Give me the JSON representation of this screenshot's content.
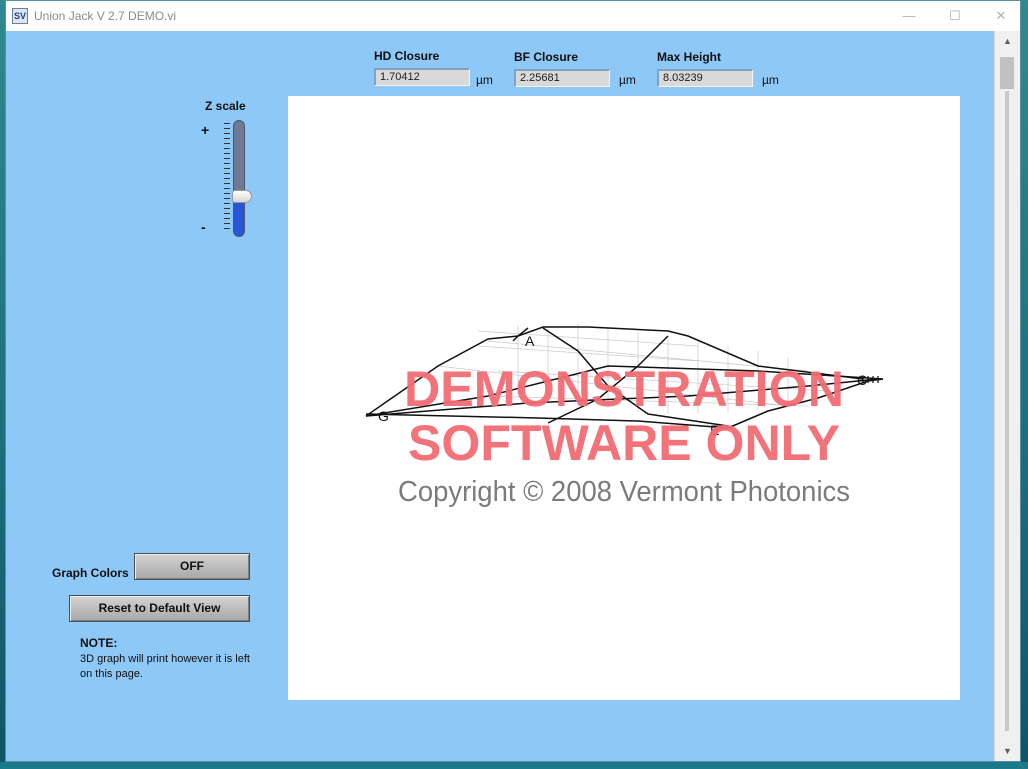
{
  "window": {
    "title": "Union Jack V 2.7 DEMO.vi",
    "icon_text": "SV",
    "minimize_glyph": "—",
    "maximize_glyph": "☐",
    "close_glyph": "✕"
  },
  "indicators": [
    {
      "label": "HD Closure",
      "value": "1.70412",
      "unit": "µm"
    },
    {
      "label": "BF Closure",
      "value": "2.25681",
      "unit": "µm"
    },
    {
      "label": "Max Height",
      "value": "8.03239",
      "unit": "µm"
    }
  ],
  "zscale": {
    "label": "Z scale",
    "plus": "+",
    "minus": "-",
    "level_fraction": 0.35
  },
  "graph": {
    "point_labels": [
      "A",
      "C",
      "G",
      "E"
    ],
    "watermark_line1": "DEMONSTRATION",
    "watermark_line2": "SOFTWARE ONLY",
    "copyright": "Copyright © 2008 Vermont Photonics",
    "watermark_color": "#f26b73"
  },
  "controls": {
    "graph_colors_label": "Graph Colors",
    "graph_colors_button": "OFF",
    "reset_button": "Reset to Default View"
  },
  "note": {
    "title": "NOTE:",
    "text": "3D graph will print however it is left on this page."
  },
  "scrollbar": {
    "up_glyph": "▲",
    "down_glyph": "▼"
  },
  "colors": {
    "panel": "#8ec8f6",
    "slider_fill": "#2b55d8"
  }
}
